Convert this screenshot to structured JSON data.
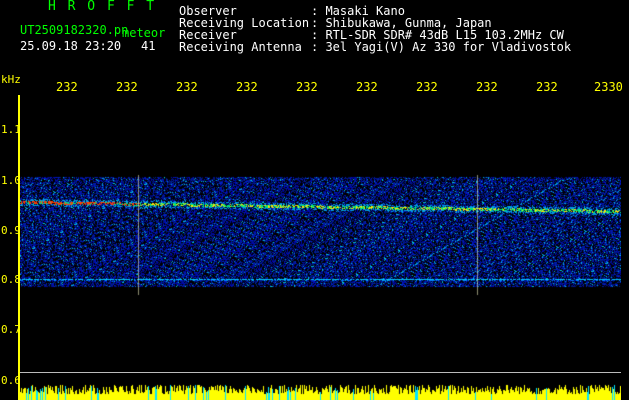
{
  "header": {
    "hroft": "H R O F F T",
    "filename": "UT2509182320.pn",
    "tag": "meteor",
    "datetime": "25.09.18 23:20",
    "count": "41",
    "observer_label": "Observer",
    "observer_value": ": Masaki Kano",
    "location_label": "Receiving Location",
    "location_value": ": Shibukawa, Gunma, Japan",
    "receiver_label": "Receiver",
    "receiver_value": ": RTL-SDR SDR# 43dB L15 103.2MHz CW",
    "antenna_label": "Receiving Antenna",
    "antenna_value": ": 3el Yagi(V) Az 330 for Vladivostok"
  },
  "y_axis": {
    "unit": "kHz",
    "ticks": [
      "1.1",
      "1.0",
      "0.9",
      "0.8",
      "0.7",
      "0.6"
    ]
  },
  "x_axis": {
    "ticks": [
      "232",
      "232",
      "232",
      "232",
      "232",
      "232",
      "232",
      "232",
      "232",
      "2330"
    ]
  },
  "colors": {
    "text_info": "#00ff00",
    "axis": "#ffff00",
    "signal_peak": "#ff3300",
    "noise": "#0033aa"
  }
}
